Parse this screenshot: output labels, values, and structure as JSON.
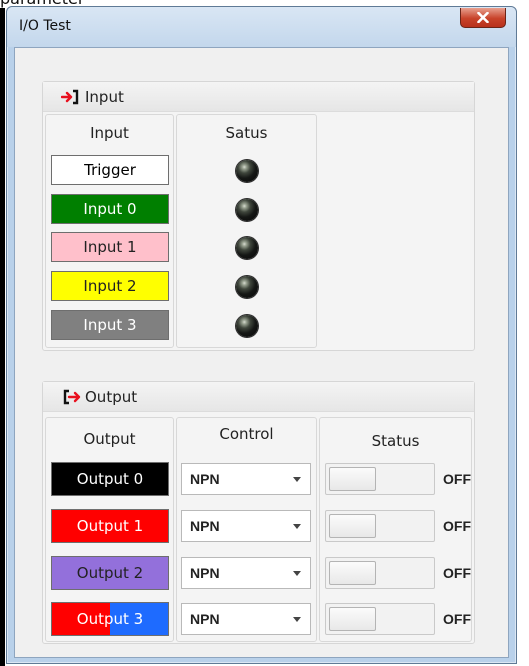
{
  "background_text": "parameter",
  "window": {
    "title": "I/O Test"
  },
  "input_section": {
    "title": "Input",
    "col_input": "Input",
    "col_status": "Satus",
    "items": [
      {
        "label": "Trigger",
        "bg": "#ffffff",
        "fg": "#000000"
      },
      {
        "label": "Input 0",
        "bg": "#007f00",
        "fg": "#ffffff"
      },
      {
        "label": "Input 1",
        "bg": "#ffc0cb",
        "fg": "#222222"
      },
      {
        "label": "Input 2",
        "bg": "#ffff00",
        "fg": "#222222"
      },
      {
        "label": "Input 3",
        "bg": "#808080",
        "fg": "#ffffff"
      }
    ]
  },
  "output_section": {
    "title": "Output",
    "col_output": "Output",
    "col_control": "Control",
    "col_status": "Status",
    "items": [
      {
        "label": "Output 0",
        "bg": "#000000",
        "fg": "#ffffff",
        "control": "NPN",
        "state": "OFF"
      },
      {
        "label": "Output 1",
        "bg": "#ff0000",
        "fg": "#ffffff",
        "control": "NPN",
        "state": "OFF"
      },
      {
        "label": "Output 2",
        "bg": "#9370db",
        "fg": "#222222",
        "control": "NPN",
        "state": "OFF"
      },
      {
        "label": "Output 3",
        "bg": "linear-gradient(90deg,#ff0000 50%,#1e6bff 50%)",
        "fg": "#ffffff",
        "control": "NPN",
        "state": "OFF"
      }
    ]
  },
  "colors": {
    "accent_red": "#e8101e",
    "titlebar": "#c3d7ec",
    "close_button": "#c8432a"
  }
}
